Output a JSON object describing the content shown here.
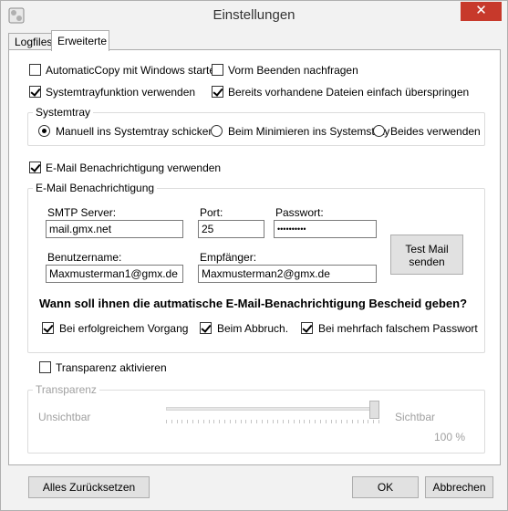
{
  "window": {
    "title": "Einstellungen",
    "close_symbol": "✕"
  },
  "tabs": [
    {
      "label": "Logfiles",
      "active": false
    },
    {
      "label": "Erweiterte",
      "active": true
    }
  ],
  "options": {
    "automatic_copy": {
      "label": "AutomaticCopy mit Windows starten",
      "checked": false
    },
    "ask_before_exit": {
      "label": "Vorm Beenden nachfragen",
      "checked": false
    },
    "systray_function": {
      "label": "Systemtrayfunktion verwenden",
      "checked": true
    },
    "skip_existing": {
      "label": "Bereits vorhandene Dateien einfach überspringen",
      "checked": true
    }
  },
  "systemtray_group": {
    "title": "Systemtray",
    "radios": [
      {
        "label": "Manuell ins Systemtray schicken",
        "checked": true
      },
      {
        "label": "Beim Minimieren ins Systemstray",
        "checked": false
      },
      {
        "label": "Beides verwenden",
        "checked": false
      }
    ]
  },
  "email_enable": {
    "label": "E-Mail Benachrichtigung verwenden",
    "checked": true
  },
  "email_group": {
    "title": "E-Mail Benachrichtigung",
    "smtp_label": "SMTP Server:",
    "smtp_value": "mail.gmx.net",
    "port_label": "Port:",
    "port_value": "25",
    "password_label": "Passwort:",
    "password_value": "••••••••••",
    "username_label": "Benutzername:",
    "username_value": "Maxmusterman1@gmx.de",
    "recipient_label": "Empfänger:",
    "recipient_value": "Maxmusterman2@gmx.de",
    "test_button_line1": "Test Mail",
    "test_button_line2": "senden",
    "question": "Wann soll ihnen die autmatische E-Mail-Benachrichtigung Bescheid geben?",
    "notify": [
      {
        "label": "Bei erfolgreichem Vorgang",
        "checked": true
      },
      {
        "label": "Beim Abbruch.",
        "checked": true
      },
      {
        "label": "Bei mehrfach falschem Passwort",
        "checked": true
      }
    ]
  },
  "transparency_enable": {
    "label": "Transparenz aktivieren",
    "checked": false
  },
  "transparency_group": {
    "title": "Transparenz",
    "left_label": "Unsichtbar",
    "right_label": "Sichtbar",
    "value_label": "100 %",
    "value": 1.0
  },
  "buttons": {
    "reset": "Alles Zurücksetzen",
    "ok": "OK",
    "cancel": "Abbrechen"
  },
  "colors": {
    "close_button": "#c7392b",
    "disabled_text": "#a0a0a0"
  }
}
